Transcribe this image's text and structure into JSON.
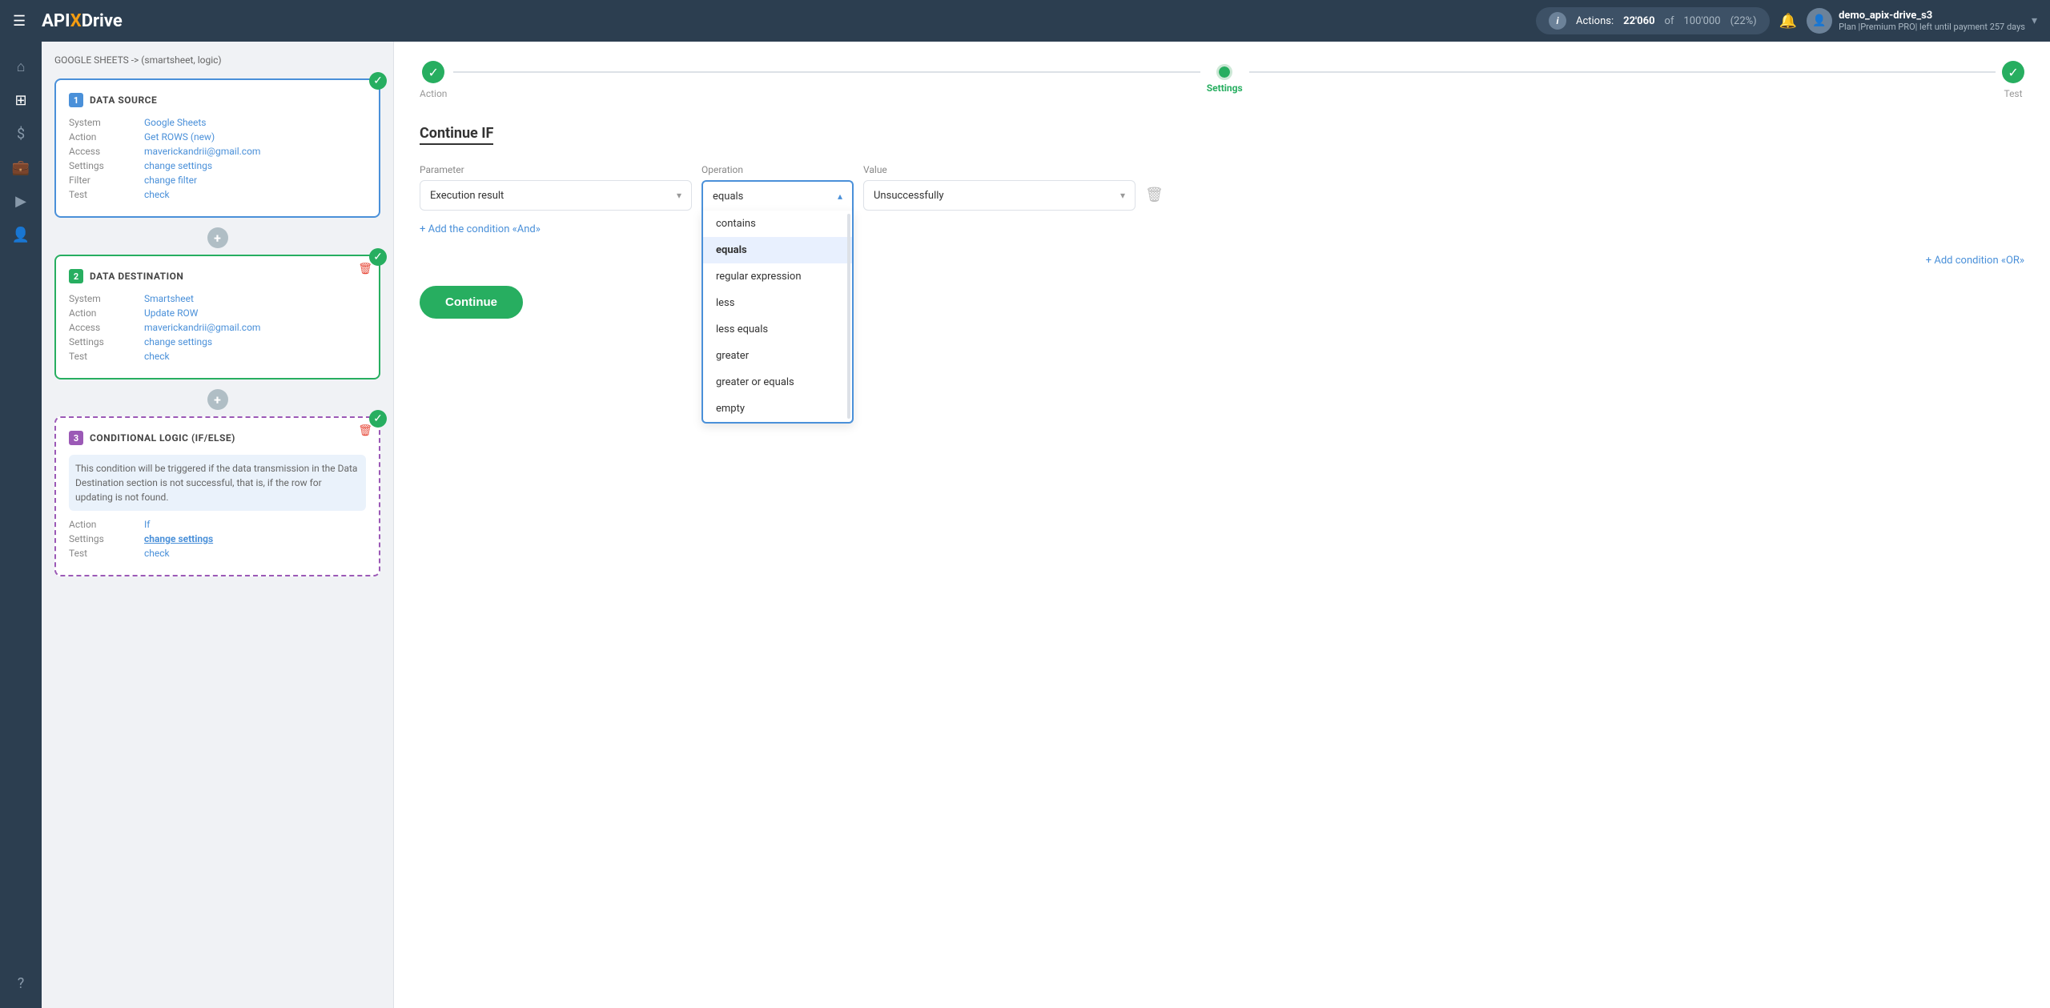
{
  "topbar": {
    "logo": "APIXDrive",
    "logo_x": "X",
    "hamburger_label": "☰",
    "actions_label": "Actions:",
    "actions_count": "22'060",
    "actions_of": "of",
    "actions_total": "100'000",
    "actions_pct": "(22%)",
    "bell_icon": "🔔",
    "user_avatar": "👤",
    "user_name": "demo_apix-drive_s3",
    "user_plan": "Plan |Premium PRO| left until payment 257 days",
    "chevron_down": "▾"
  },
  "sidebar": {
    "icons": [
      {
        "name": "home",
        "symbol": "⌂"
      },
      {
        "name": "diagram",
        "symbol": "⊞"
      },
      {
        "name": "dollar",
        "symbol": "$"
      },
      {
        "name": "briefcase",
        "symbol": "💼"
      },
      {
        "name": "play",
        "symbol": "▶"
      },
      {
        "name": "person",
        "symbol": "👤"
      },
      {
        "name": "help",
        "symbol": "?"
      }
    ]
  },
  "breadcrumb": "GOOGLE SHEETS -> (smartsheet, logic)",
  "cards": [
    {
      "id": 1,
      "num": "1",
      "num_color": "blue",
      "title": "DATA SOURCE",
      "border": "blue",
      "has_badge": true,
      "has_delete": false,
      "rows": [
        {
          "label": "System",
          "value": "Google Sheets",
          "bold": false
        },
        {
          "label": "Action",
          "value": "Get ROWS (new)",
          "bold": false
        },
        {
          "label": "Access",
          "value": "maverickandrii@gmail.com",
          "bold": false
        },
        {
          "label": "Settings",
          "value": "change settings",
          "bold": false
        },
        {
          "label": "Filter",
          "value": "change filter",
          "bold": false
        },
        {
          "label": "Test",
          "value": "check",
          "bold": false
        }
      ]
    },
    {
      "id": 2,
      "num": "2",
      "num_color": "green",
      "title": "DATA DESTINATION",
      "border": "green",
      "has_badge": true,
      "has_delete": true,
      "rows": [
        {
          "label": "System",
          "value": "Smartsheet",
          "bold": false
        },
        {
          "label": "Action",
          "value": "Update ROW",
          "bold": false
        },
        {
          "label": "Access",
          "value": "maverickandrii@gmail.com",
          "bold": false
        },
        {
          "label": "Settings",
          "value": "change settings",
          "bold": false
        },
        {
          "label": "Test",
          "value": "check",
          "bold": false
        }
      ]
    },
    {
      "id": 3,
      "num": "3",
      "num_color": "purple",
      "title": "CONDITIONAL LOGIC (IF/ELSE)",
      "border": "purple",
      "has_badge": true,
      "has_delete": true,
      "description": "This condition will be triggered if the data transmission in the Data Destination section is not successful, that is, if the row for updating is not found.",
      "rows": [
        {
          "label": "Action",
          "value": "If",
          "bold": false
        },
        {
          "label": "Settings",
          "value": "change settings",
          "bold": true
        },
        {
          "label": "Test",
          "value": "check",
          "bold": false
        }
      ]
    }
  ],
  "right_panel": {
    "steps": [
      {
        "label": "Action",
        "state": "done"
      },
      {
        "label": "Settings",
        "state": "active"
      },
      {
        "label": "Test",
        "state": "done"
      }
    ],
    "title": "Continue IF",
    "parameter_label": "Parameter",
    "operation_label": "Operation",
    "value_label": "Value",
    "parameter_value": "Execution result",
    "operation_value": "equals",
    "value_selected": "Unsuccessfully",
    "add_and_label": "+ Add the condition «And»",
    "add_or_label": "+ Add condition «OR»",
    "continue_button": "Continue",
    "operation_options": [
      {
        "value": "contains",
        "label": "contains"
      },
      {
        "value": "equals",
        "label": "equals"
      },
      {
        "value": "regular_expression",
        "label": "regular expression"
      },
      {
        "value": "less",
        "label": "less"
      },
      {
        "value": "less_equals",
        "label": "less equals"
      },
      {
        "value": "greater",
        "label": "greater"
      },
      {
        "value": "greater_or_equals",
        "label": "greater or equals"
      },
      {
        "value": "empty",
        "label": "empty"
      }
    ]
  }
}
